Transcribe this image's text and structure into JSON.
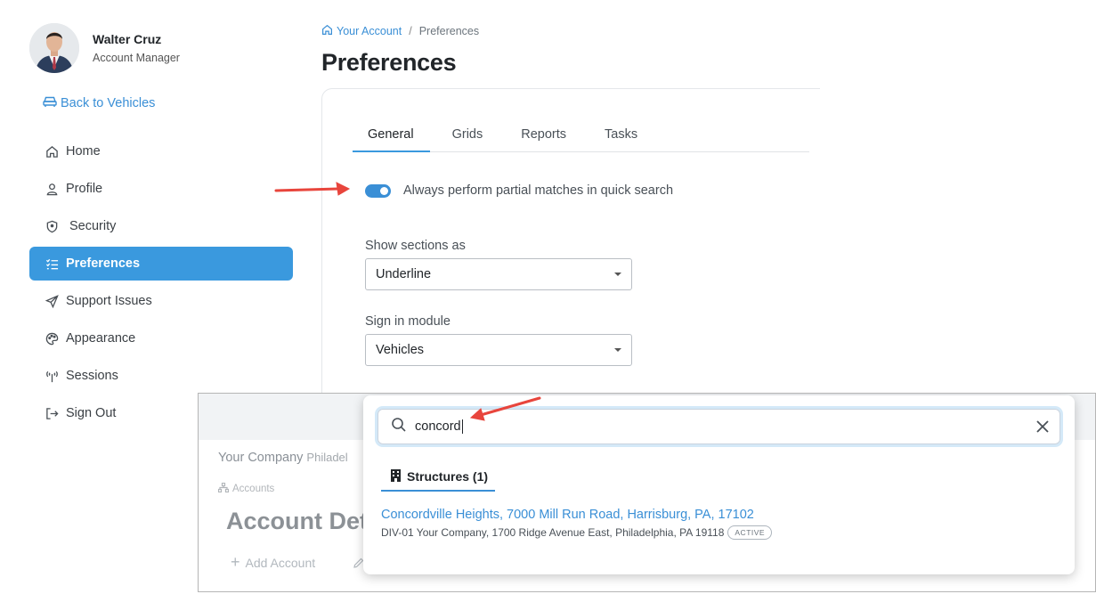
{
  "user": {
    "name": "Walter Cruz",
    "role": "Account Manager"
  },
  "sidebar": {
    "back_label": "Back to Vehicles",
    "items": [
      {
        "label": "Home",
        "icon": "home-icon",
        "active": false
      },
      {
        "label": "Profile",
        "icon": "user-icon",
        "active": false
      },
      {
        "label": "Security",
        "icon": "shield-icon",
        "active": false
      },
      {
        "label": "Preferences",
        "icon": "list-check-icon",
        "active": true
      },
      {
        "label": "Support Issues",
        "icon": "paper-plane-icon",
        "active": false
      },
      {
        "label": "Appearance",
        "icon": "palette-icon",
        "active": false
      },
      {
        "label": "Sessions",
        "icon": "broadcast-icon",
        "active": false
      },
      {
        "label": "Sign Out",
        "icon": "sign-out-icon",
        "active": false
      }
    ]
  },
  "breadcrumb": {
    "parent": "Your Account",
    "separator": "/",
    "current": "Preferences"
  },
  "page": {
    "title": "Preferences"
  },
  "tabs": [
    {
      "label": "General",
      "active": true
    },
    {
      "label": "Grids",
      "active": false
    },
    {
      "label": "Reports",
      "active": false
    },
    {
      "label": "Tasks",
      "active": false
    }
  ],
  "general": {
    "partial_match_label": "Always perform partial matches in quick search",
    "partial_match_enabled": true,
    "sections_label": "Show sections as",
    "sections_value": "Underline",
    "module_label": "Sign in module",
    "module_value": "Vehicles"
  },
  "background": {
    "company": "Your Company",
    "company_city": "Philadel",
    "crumb": "Accounts",
    "title": "Account Det",
    "add_label": "Add Account"
  },
  "search_popup": {
    "query": "concord",
    "category_label": "Structures (1)",
    "result_title": "Concordville Heights, 7000 Mill Run Road, Harrisburg, PA, 17102",
    "result_subtitle": "DIV-01 Your Company, 1700 Ridge Avenue East, Philadelphia, PA 19118",
    "result_badge": "ACTIVE"
  },
  "colors": {
    "accent": "#3a99de",
    "link": "#3a8fd6",
    "annotation_arrow": "#e8453c"
  }
}
